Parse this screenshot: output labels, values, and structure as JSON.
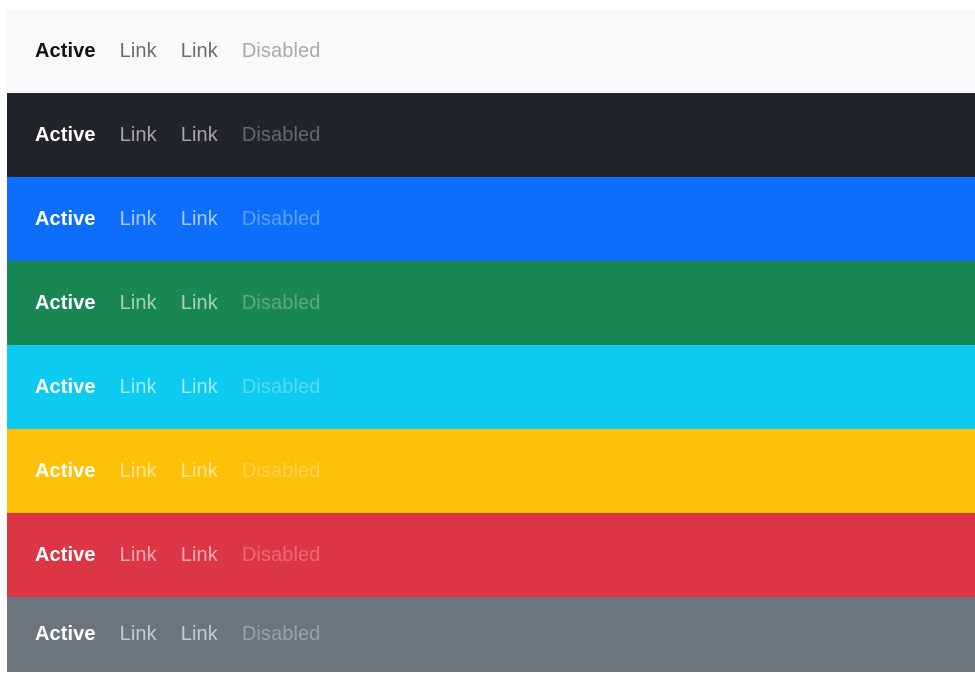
{
  "navbars": [
    {
      "variant": "light",
      "bg": "#f8f9fa",
      "items": [
        {
          "label": "Active",
          "state": "active",
          "color": "#111111"
        },
        {
          "label": "Link",
          "state": "link",
          "color": "#6c6c6c"
        },
        {
          "label": "Link",
          "state": "link",
          "color": "#6c6c6c"
        },
        {
          "label": "Disabled",
          "state": "disabled",
          "color": "#a9a9a9"
        }
      ]
    },
    {
      "variant": "dark",
      "bg": "#212529",
      "items": [
        {
          "label": "Active",
          "state": "active",
          "color": "#ffffff"
        },
        {
          "label": "Link",
          "state": "link",
          "color": "#a5a6a8"
        },
        {
          "label": "Link",
          "state": "link",
          "color": "#a5a6a8"
        },
        {
          "label": "Disabled",
          "state": "disabled",
          "color": "#65686c"
        }
      ]
    },
    {
      "variant": "primary",
      "bg": "#0d6efd",
      "items": [
        {
          "label": "Active",
          "state": "active",
          "color": "#ffffff"
        },
        {
          "label": "Link",
          "state": "link",
          "color": "#a9cdfe"
        },
        {
          "label": "Link",
          "state": "link",
          "color": "#a9cdfe"
        },
        {
          "label": "Disabled",
          "state": "disabled",
          "color": "#5da0fd"
        }
      ]
    },
    {
      "variant": "success",
      "bg": "#198754",
      "items": [
        {
          "label": "Active",
          "state": "active",
          "color": "#ffffff"
        },
        {
          "label": "Link",
          "state": "link",
          "color": "#a5d2bd"
        },
        {
          "label": "Link",
          "state": "link",
          "color": "#a5d2bd"
        },
        {
          "label": "Disabled",
          "state": "disabled",
          "color": "#5aa985"
        }
      ]
    },
    {
      "variant": "info",
      "bg": "#0dcaf0",
      "items": [
        {
          "label": "Active",
          "state": "active",
          "color": "#ffffff"
        },
        {
          "label": "Link",
          "state": "link",
          "color": "#a0ecfb"
        },
        {
          "label": "Link",
          "state": "link",
          "color": "#a0ecfb"
        },
        {
          "label": "Disabled",
          "state": "disabled",
          "color": "#55dbf5"
        }
      ]
    },
    {
      "variant": "warning",
      "bg": "#ffc107",
      "items": [
        {
          "label": "Active",
          "state": "active",
          "color": "#ffffff"
        },
        {
          "label": "Link",
          "state": "link",
          "color": "#ffe49b"
        },
        {
          "label": "Link",
          "state": "link",
          "color": "#ffe49b"
        },
        {
          "label": "Disabled",
          "state": "disabled",
          "color": "#ffd252"
        }
      ]
    },
    {
      "variant": "danger",
      "bg": "#dc3545",
      "items": [
        {
          "label": "Active",
          "state": "active",
          "color": "#ffffff"
        },
        {
          "label": "Link",
          "state": "link",
          "color": "#f2aab3"
        },
        {
          "label": "Link",
          "state": "link",
          "color": "#f2aab3"
        },
        {
          "label": "Disabled",
          "state": "disabled",
          "color": "#e76b79"
        }
      ]
    },
    {
      "variant": "secondary",
      "bg": "#6c757d",
      "items": [
        {
          "label": "Active",
          "state": "active",
          "color": "#ffffff"
        },
        {
          "label": "Link",
          "state": "link",
          "color": "#c7cacd"
        },
        {
          "label": "Link",
          "state": "link",
          "color": "#c7cacd"
        },
        {
          "label": "Disabled",
          "state": "disabled",
          "color": "#9aa0a5"
        }
      ]
    }
  ]
}
